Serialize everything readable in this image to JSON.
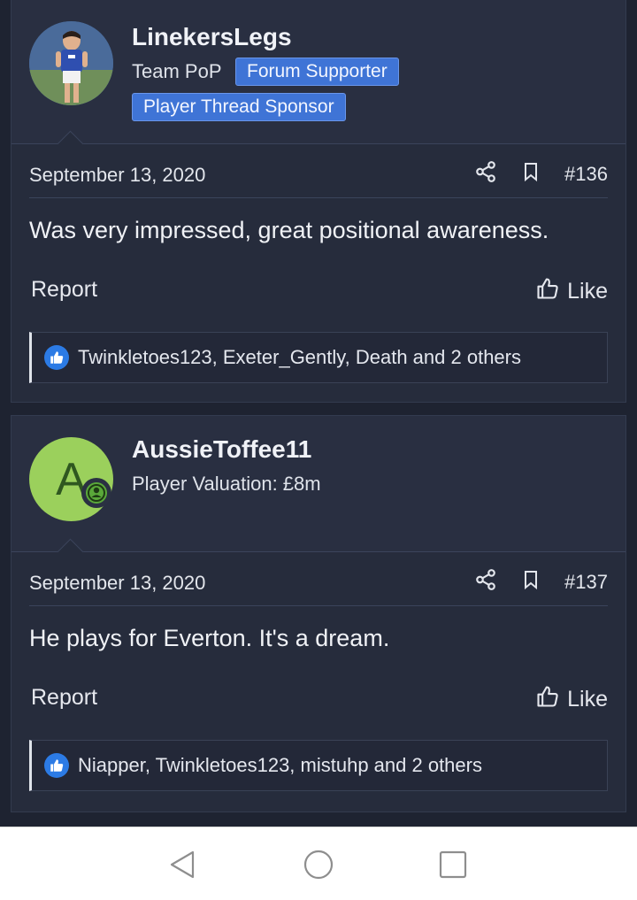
{
  "posts": [
    {
      "username": "LinekersLegs",
      "user_title": "Team PoP",
      "badges": [
        "Forum Supporter",
        "Player Thread Sponsor"
      ],
      "avatar_type": "photo",
      "date": "September 13, 2020",
      "post_number": "#136",
      "body": "Was very impressed, great positional awareness.",
      "report_label": "Report",
      "like_label": "Like",
      "reactions": "Twinkletoes123, Exeter_Gently, Death and 2 others"
    },
    {
      "username": "AussieToffee11",
      "user_title": "Player Valuation: £8m",
      "avatar_letter": "A",
      "avatar_color": "#9bd05c",
      "date": "September 13, 2020",
      "post_number": "#137",
      "body": "He plays for Everton. It's a dream.",
      "report_label": "Report",
      "like_label": "Like",
      "reactions": "Niapper, Twinkletoes123, mistuhp and 2 others"
    }
  ],
  "icons": {
    "share": "share-icon",
    "bookmark": "bookmark-icon",
    "like": "thumbs-up-icon",
    "reaction": "like-reaction-icon",
    "online": "user-online-icon"
  },
  "colors": {
    "background": "#1e2331",
    "post_bg": "#262c3c",
    "badge_blue": "#3f74d6",
    "reaction_blue": "#2c7be5"
  },
  "nav": [
    "back-button",
    "home-button",
    "recents-button"
  ]
}
